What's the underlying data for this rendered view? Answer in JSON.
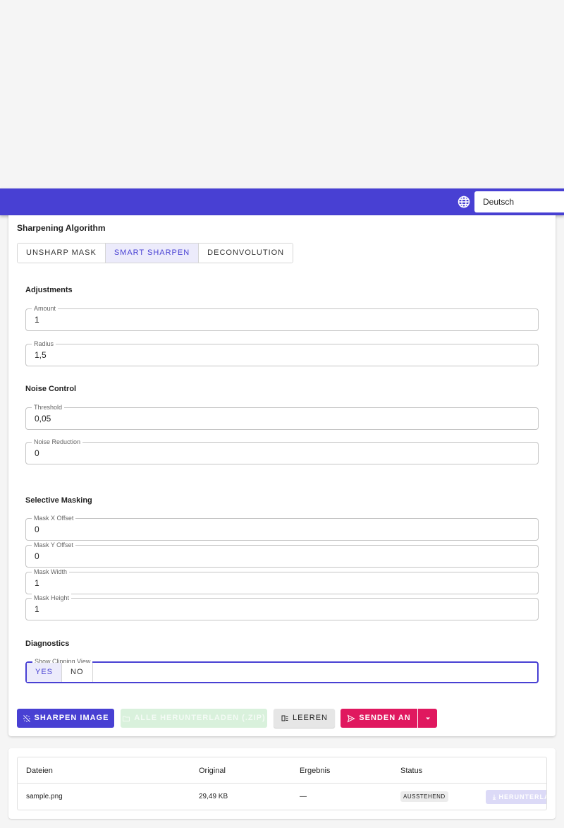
{
  "header": {
    "language": "Deutsch",
    "icon": "globe-icon",
    "accent": "#4840d3"
  },
  "algorithm": {
    "title": "Sharpening Algorithm",
    "options": [
      "UNSHARP MASK",
      "SMART SHARPEN",
      "DECONVOLUTION"
    ],
    "selected": "SMART SHARPEN"
  },
  "adjustments": {
    "title": "Adjustments",
    "amount": {
      "label": "Amount",
      "value": "1"
    },
    "radius": {
      "label": "Radius",
      "value": "1,5"
    }
  },
  "noise": {
    "title": "Noise Control",
    "threshold": {
      "label": "Threshold",
      "value": "0,05"
    },
    "reduction": {
      "label": "Noise Reduction",
      "value": "0"
    }
  },
  "masking": {
    "title": "Selective Masking",
    "x_offset": {
      "label": "Mask X Offset",
      "value": "0"
    },
    "y_offset": {
      "label": "Mask Y Offset",
      "value": "0"
    },
    "width": {
      "label": "Mask Width",
      "value": "1"
    },
    "height": {
      "label": "Mask Height",
      "value": "1"
    }
  },
  "diagnostics": {
    "title": "Diagnostics",
    "clipping_label": "Show Clipping View",
    "yes": "YES",
    "no": "NO",
    "selected": "YES"
  },
  "actions": {
    "sharpen": "SHARPEN IMAGE",
    "download_all": "ALLE HERUNTERLADEN (.ZIP)",
    "clear": "LEEREN",
    "send": "SENDEN AN",
    "sharpen_color": "#4840d3",
    "send_color": "#e0185f"
  },
  "files_table": {
    "columns": [
      "Dateien",
      "Original",
      "Ergebnis",
      "Status"
    ],
    "rows": [
      {
        "name": "sample.png",
        "original": "29,49 KB",
        "result": "—",
        "status": "AUSSTEHEND",
        "download": "HERUNTERLADEN"
      }
    ]
  }
}
